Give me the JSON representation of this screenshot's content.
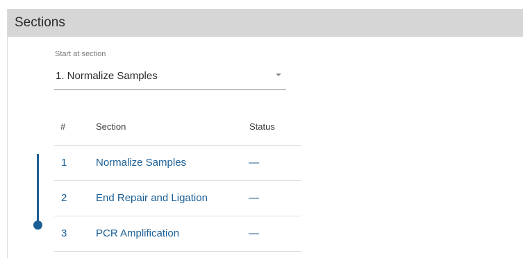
{
  "panel": {
    "title": "Sections"
  },
  "start_section": {
    "label": "Start at section",
    "selected": "1. Normalize Samples",
    "caret_icon": "caret-down-icon"
  },
  "table": {
    "headers": {
      "num": "#",
      "section": "Section",
      "status": "Status"
    },
    "rows": [
      {
        "num": "1",
        "section": "Normalize Samples",
        "status": "—"
      },
      {
        "num": "2",
        "section": "End Repair and Ligation",
        "status": "—"
      },
      {
        "num": "3",
        "section": "PCR Amplification",
        "status": "—"
      }
    ]
  },
  "colors": {
    "accent": "#1b5f95",
    "header_bg": "#d6d6d6",
    "divider": "#dedede"
  }
}
